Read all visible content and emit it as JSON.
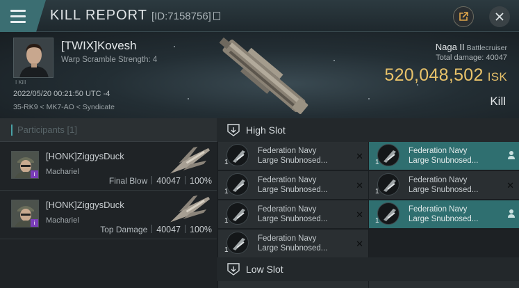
{
  "header": {
    "title": "KILL REPORT",
    "id_text": "[ID:7158756]"
  },
  "summary": {
    "pilot_name": "[TWIX]Kovesh",
    "scramble": "Warp Scramble Strength: 4",
    "small_tag": "I Kill",
    "datetime": "2022/05/20 00:21:50 UTC -4",
    "location": "35-RK9 < MK7-AO < Syndicate",
    "ship_name": "Naga II",
    "ship_class": "Battlecruiser",
    "total_damage_label": "Total damage:",
    "total_damage": "40047",
    "isk_value": "520,048,502",
    "isk_unit": "ISK",
    "result": "Kill"
  },
  "participants": {
    "header": "Participants [1]",
    "rows": [
      {
        "name": "[HONK]ZiggysDuck",
        "ship": "Machariel",
        "role": "Final Blow",
        "damage": "40047",
        "percent": "100%",
        "badge": "i"
      },
      {
        "name": "[HONK]ZiggysDuck",
        "ship": "Machariel",
        "role": "Top Damage",
        "damage": "40047",
        "percent": "100%",
        "badge": "i"
      }
    ]
  },
  "high_slot": {
    "label": "High Slot",
    "left": [
      {
        "line1": "Federation Navy",
        "line2": "Large Snubnosed...",
        "qty": "1",
        "state": "destroyed"
      },
      {
        "line1": "Federation Navy",
        "line2": "Large Snubnosed...",
        "qty": "1",
        "state": "destroyed"
      },
      {
        "line1": "Federation Navy",
        "line2": "Large Snubnosed...",
        "qty": "1",
        "state": "destroyed"
      },
      {
        "line1": "Federation Navy",
        "line2": "Large Snubnosed...",
        "qty": "1",
        "state": "destroyed"
      }
    ],
    "right": [
      {
        "line1": "Federation Navy",
        "line2": "Large Snubnosed...",
        "qty": "1",
        "state": "dropped"
      },
      {
        "line1": "Federation Navy",
        "line2": "Large Snubnosed...",
        "qty": "1",
        "state": "destroyed"
      },
      {
        "line1": "Federation Navy",
        "line2": "Large Snubnosed...",
        "qty": "1",
        "state": "dropped"
      }
    ]
  },
  "low_slot": {
    "label": "Low Slot"
  },
  "colors": {
    "accent": "#3b6e72",
    "isk": "#e8c26a",
    "dropped": "#2f6f70",
    "destroyed": "#2a2f32",
    "badge": "#7a3db8"
  }
}
